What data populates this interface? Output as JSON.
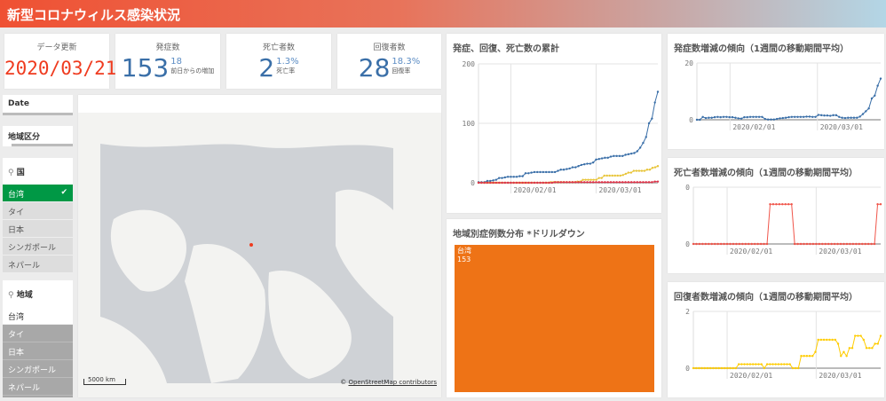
{
  "header": {
    "title": "新型コロナウィルス感染状況"
  },
  "kpis": {
    "update": {
      "label": "データ更新",
      "value": "2020/03/21"
    },
    "cases": {
      "label": "発症数",
      "value": "153",
      "sub_value": "18",
      "sub_label": "前日からの増加"
    },
    "deaths": {
      "label": "死亡者数",
      "value": "2",
      "sub_value": "1.3%",
      "sub_label": "死亡率"
    },
    "recovered": {
      "label": "回復者数",
      "value": "28",
      "sub_value": "18.3%",
      "sub_label": "回復率"
    }
  },
  "filters": {
    "date": "Date",
    "region_type": "地域区分",
    "country": {
      "label": "国",
      "items": [
        "台湾",
        "タイ",
        "日本",
        "シンガポール",
        "ネパール"
      ],
      "selected": "台湾"
    },
    "region": {
      "label": "地域",
      "items": [
        "台湾",
        "タイ",
        "日本",
        "シンガポール",
        "ネパール"
      ]
    }
  },
  "map": {
    "scale": "5000 km",
    "attribution_prefix": "© ",
    "attribution_link": "OpenStreetMap contributors"
  },
  "treemap": {
    "title": "地域別症例数分布 *ドリルダウン",
    "cells": [
      {
        "label": "台湾",
        "value": "153"
      }
    ]
  },
  "colors": {
    "cases": "#3a6fa8",
    "recovered": "#e8c53a",
    "deaths": "#e0344a",
    "treemap": "#ee7316",
    "trend_deaths": "#f0554a",
    "trend_recovered": "#ffcc00"
  },
  "chart_data": [
    {
      "type": "line",
      "title": "発症、回復、死亡数の累計",
      "x_ticks": [
        "2020/02/01",
        "2020/03/01"
      ],
      "ylim": [
        0,
        200
      ],
      "y_ticks": [
        "0",
        "100",
        "200"
      ],
      "series": [
        {
          "name": "発症",
          "values": [
            1,
            1,
            1,
            3,
            3,
            4,
            5,
            8,
            8,
            9,
            10,
            10,
            10,
            10,
            11,
            11,
            16,
            16,
            17,
            18,
            18,
            18,
            18,
            18,
            18,
            18,
            18,
            20,
            22,
            22,
            23,
            24,
            26,
            26,
            28,
            30,
            31,
            32,
            32,
            34,
            39,
            40,
            41,
            42,
            42,
            44,
            45,
            45,
            45,
            45,
            47,
            48,
            49,
            50,
            53,
            59,
            67,
            77,
            100,
            108,
            135,
            153
          ]
        },
        {
          "name": "回復",
          "values": [
            0,
            0,
            0,
            0,
            0,
            0,
            0,
            0,
            0,
            0,
            0,
            0,
            0,
            0,
            0,
            0,
            0,
            0,
            0,
            0,
            0,
            0,
            0,
            0,
            0,
            0,
            0,
            1,
            1,
            1,
            1,
            1,
            1,
            1,
            1,
            1,
            1,
            2,
            2,
            5,
            5,
            5,
            5,
            5,
            5,
            8,
            8,
            12,
            12,
            12,
            12,
            12,
            12,
            12,
            13,
            15,
            17,
            17,
            20,
            20,
            20,
            20,
            20,
            22,
            22,
            25,
            26,
            28
          ]
        },
        {
          "name": "死亡",
          "values": [
            0,
            0,
            0,
            0,
            0,
            0,
            0,
            0,
            0,
            0,
            0,
            0,
            0,
            0,
            0,
            0,
            0,
            0,
            0,
            0,
            0,
            0,
            0,
            0,
            0,
            0,
            1,
            1,
            1,
            1,
            1,
            1,
            1,
            1,
            1,
            1,
            1,
            1,
            1,
            1,
            1,
            1,
            1,
            1,
            1,
            1,
            1,
            1,
            1,
            1,
            1,
            1,
            1,
            1,
            1,
            1,
            1,
            1,
            1,
            1,
            2,
            2
          ]
        }
      ]
    },
    {
      "type": "line",
      "title": "発症数増減の傾向（1週間の移動期間平均）",
      "x_ticks": [
        "2020/02/01",
        "2020/03/01"
      ],
      "ylim": [
        0,
        20
      ],
      "y_ticks": [
        "0",
        "20"
      ],
      "series": [
        {
          "name": "発症",
          "values": [
            0,
            0,
            1,
            0.6,
            0.7,
            0.7,
            0.9,
            1,
            0.9,
            1,
            1,
            0.9,
            0.9,
            0.7,
            0.5,
            0.4,
            0.9,
            0.9,
            1,
            1,
            1,
            1,
            1,
            0.3,
            0.1,
            0.1,
            0.1,
            0.3,
            0.5,
            0.6,
            0.7,
            0.9,
            1,
            1,
            1,
            1,
            1,
            1.1,
            1.1,
            1,
            1,
            1.7,
            1.6,
            1.5,
            1.5,
            1.4,
            1.6,
            1.6,
            1,
            0.7,
            0.6,
            0.7,
            0.7,
            0.7,
            0.7,
            1.1,
            2,
            3,
            4,
            7.5,
            8.5,
            12,
            14.5
          ]
        }
      ]
    },
    {
      "type": "line",
      "title": "死亡者数増減の傾向（1週間の移動期間平均）",
      "x_ticks": [
        "2020/02/01",
        "2020/03/01"
      ],
      "ylim": [
        0,
        0.2
      ],
      "y_ticks": [
        "0",
        "0"
      ],
      "series": [
        {
          "name": "死亡",
          "values": [
            0,
            0,
            0,
            0,
            0,
            0,
            0,
            0,
            0,
            0,
            0,
            0,
            0,
            0,
            0,
            0,
            0,
            0,
            0,
            0,
            0,
            0,
            0,
            0,
            0,
            0.14,
            0.14,
            0.14,
            0.14,
            0.14,
            0.14,
            0.14,
            0.14,
            0,
            0,
            0,
            0,
            0,
            0,
            0,
            0,
            0,
            0,
            0,
            0,
            0,
            0,
            0,
            0,
            0,
            0,
            0,
            0,
            0,
            0,
            0,
            0,
            0,
            0,
            0,
            0.14,
            0.14
          ]
        }
      ]
    },
    {
      "type": "line",
      "title": "回復者数増減の傾向（1週間の移動期間平均）",
      "x_ticks": [
        "2020/02/01",
        "2020/03/01"
      ],
      "ylim": [
        0,
        2
      ],
      "y_ticks": [
        "0",
        "2"
      ],
      "series": [
        {
          "name": "回復",
          "values": [
            0,
            0,
            0,
            0,
            0,
            0,
            0,
            0,
            0,
            0,
            0,
            0,
            0,
            0,
            0,
            0,
            0.14,
            0.14,
            0.14,
            0.14,
            0.14,
            0.14,
            0.14,
            0.14,
            0.14,
            0,
            0.14,
            0.14,
            0.14,
            0.14,
            0.14,
            0.14,
            0.14,
            0.14,
            0.14,
            0,
            0,
            0,
            0.43,
            0.43,
            0.43,
            0.43,
            0.43,
            0.57,
            1,
            1,
            1,
            1,
            1,
            1,
            1,
            0.86,
            0.43,
            0.57,
            0.43,
            0.71,
            0.71,
            1.14,
            1.14,
            1.14,
            1,
            0.71,
            0.71,
            0.71,
            0.86,
            0.86,
            1.14
          ]
        }
      ]
    }
  ]
}
